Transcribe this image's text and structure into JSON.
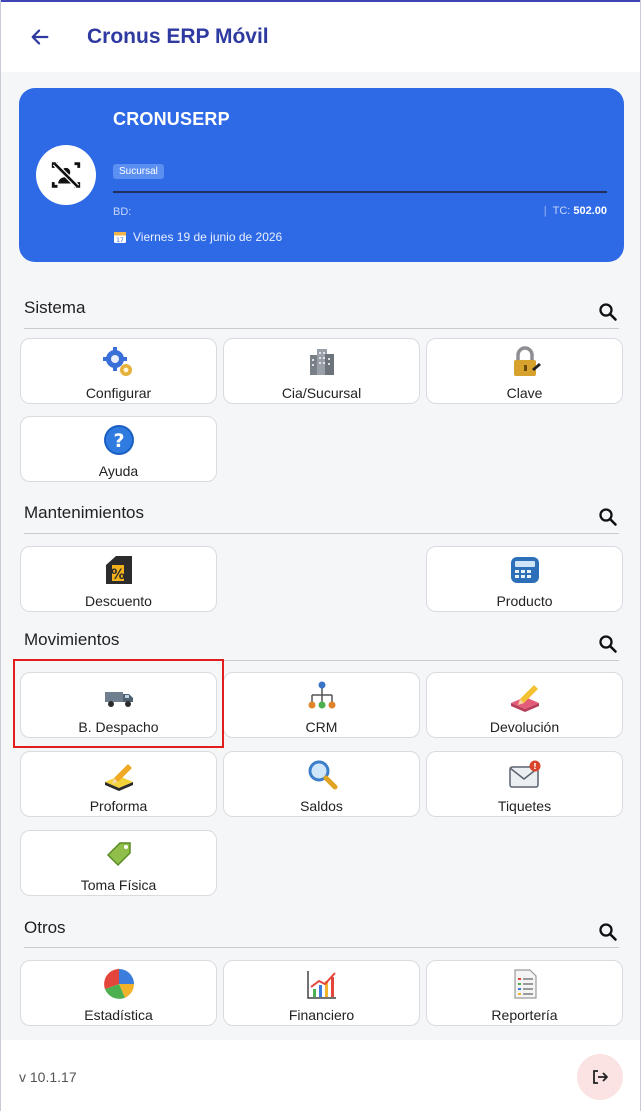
{
  "app": {
    "title": "Cronus ERP Móvil"
  },
  "company_card": {
    "name": "CRONUSERP",
    "branch_badge": "Sucursal",
    "bd_label": "BD:",
    "tc_label": "TC:",
    "tc_value": "502.00",
    "date": "Viernes 19 de junio de 2026"
  },
  "sections": {
    "sistema": {
      "title": "Sistema",
      "items": [
        "Configurar",
        "Cia/Sucursal",
        "Clave",
        "Ayuda"
      ]
    },
    "mantenimientos": {
      "title": "Mantenimientos",
      "items": [
        "Descuento",
        "Producto"
      ]
    },
    "movimientos": {
      "title": "Movimientos",
      "items": [
        "B. Despacho",
        "CRM",
        "Devolución",
        "Proforma",
        "Saldos",
        "Tiquetes",
        "Toma Física"
      ]
    },
    "otros": {
      "title": "Otros",
      "items": [
        "Estadística",
        "Financiero",
        "Reportería"
      ]
    }
  },
  "footer": {
    "version": "v 10.1.17"
  },
  "colors": {
    "primary": "#2f6ae6",
    "title": "#2e3aa0",
    "highlight": "#e11d1d"
  }
}
